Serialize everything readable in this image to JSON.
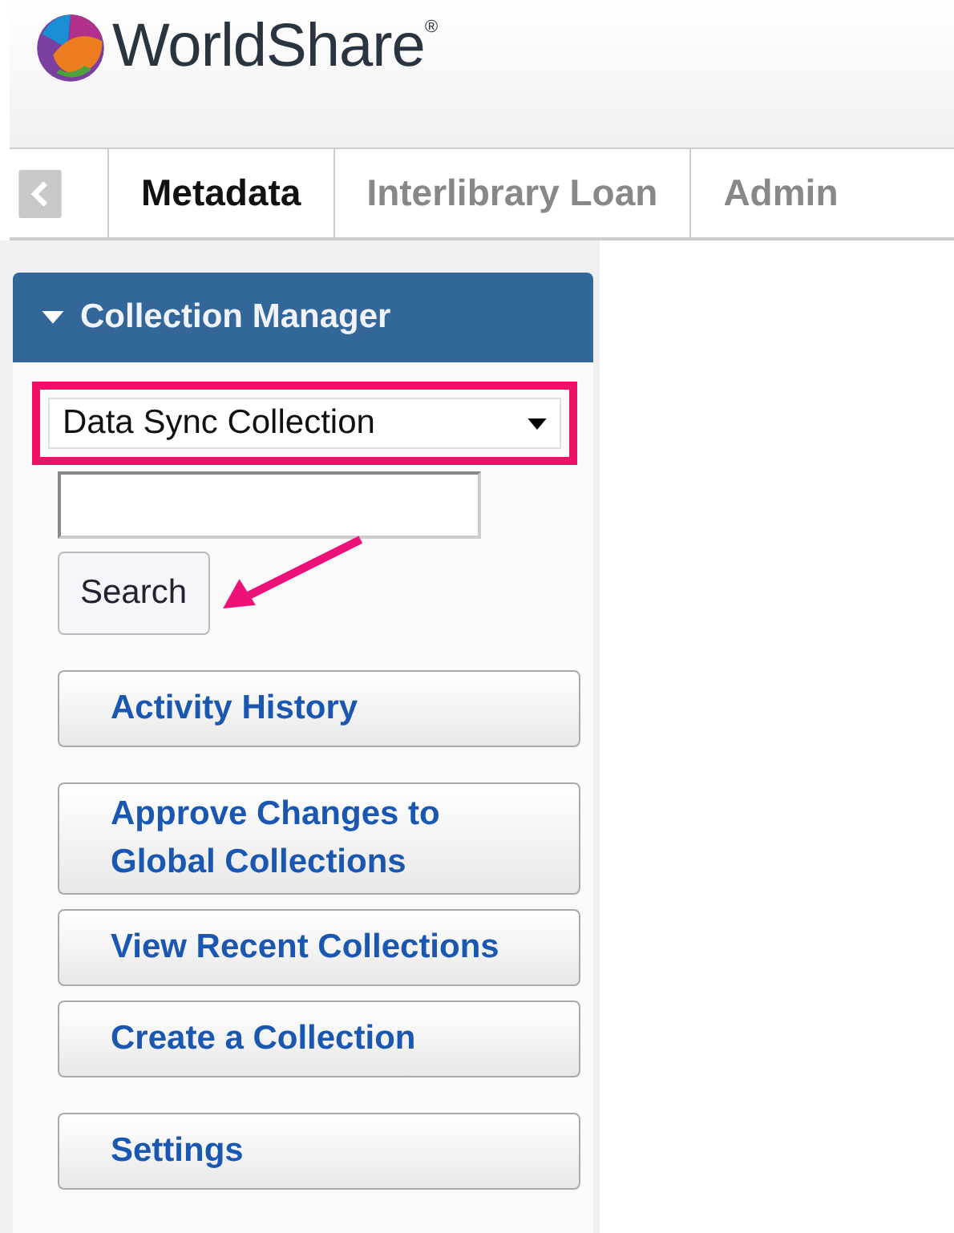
{
  "header": {
    "logo_text": "WorldShare$^{®}$"
  },
  "tabs": [
    {
      "label": "Metadata",
      "selected": true
    },
    {
      "label": "Interlibrary Loan",
      "selected": false
    },
    {
      "label": "Admin",
      "selected": false
    }
  ],
  "panel": {
    "title": "Collection Manager",
    "expanded": true,
    "collection_select": {
      "value": "Data Sync Collection",
      "highlighted": true
    },
    "search_button": "Search",
    "menu_groups": [
      [
        "Activity History"
      ],
      [
        "Approve Changes to Global Collections",
        "View Recent Collections",
        "Create a Collection"
      ],
      [
        "Settings"
      ]
    ]
  }
}
